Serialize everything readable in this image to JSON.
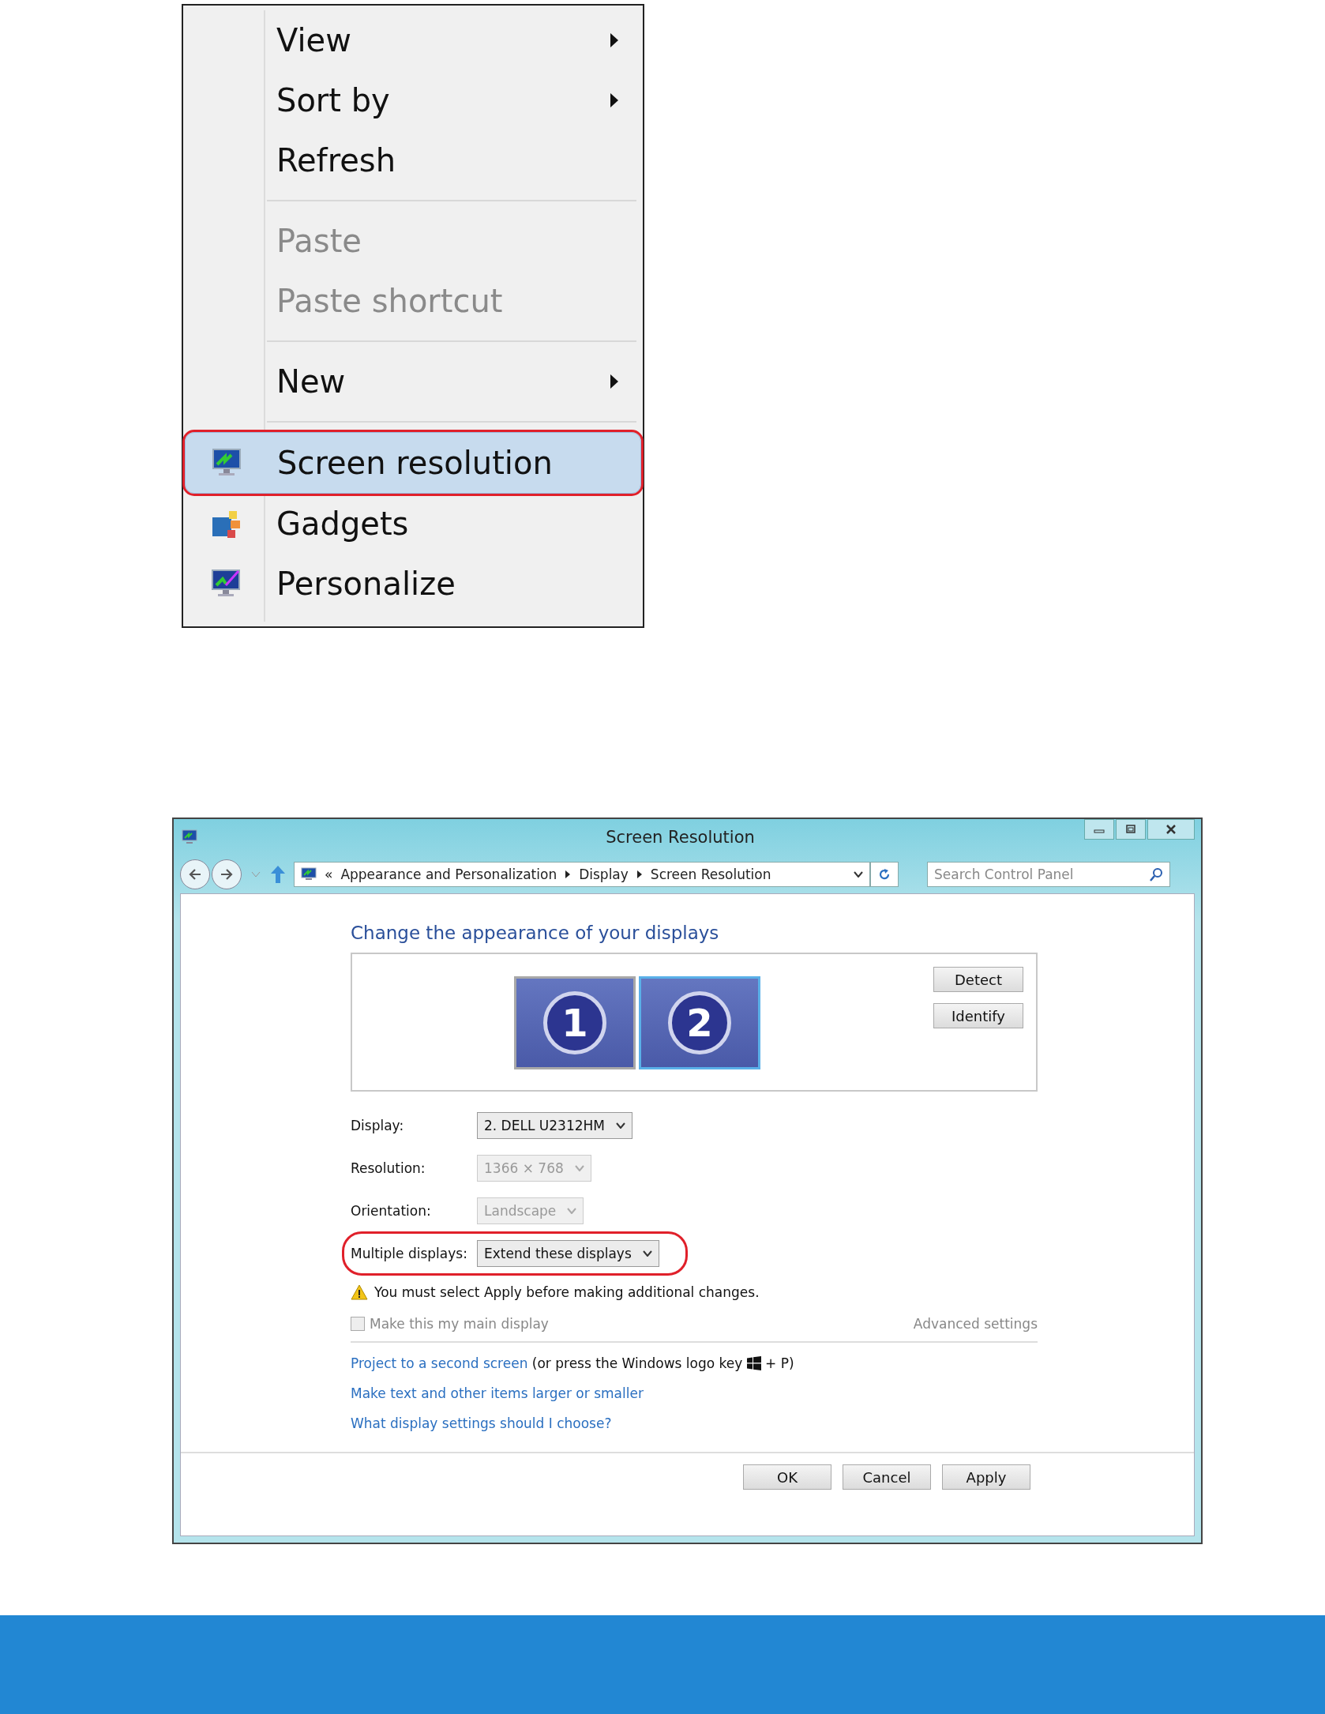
{
  "context_menu": {
    "sections": [
      {
        "items": [
          {
            "label": "View",
            "submenu": true,
            "disabled": false,
            "selected": false,
            "callout": false,
            "kind": "plain"
          },
          {
            "label": "Sort by",
            "submenu": true,
            "disabled": false,
            "selected": false,
            "callout": false,
            "kind": "plain"
          },
          {
            "label": "Refresh",
            "submenu": false,
            "disabled": false,
            "selected": false,
            "callout": false,
            "kind": "plain"
          }
        ]
      },
      {
        "items": [
          {
            "label": "Paste",
            "submenu": false,
            "disabled": true,
            "selected": false,
            "callout": false,
            "kind": "plain"
          },
          {
            "label": "Paste shortcut",
            "submenu": false,
            "disabled": true,
            "selected": false,
            "callout": false,
            "kind": "plain"
          }
        ]
      },
      {
        "items": [
          {
            "label": "New",
            "submenu": true,
            "disabled": false,
            "selected": false,
            "callout": false,
            "kind": "plain"
          }
        ]
      },
      {
        "items": [
          {
            "label": "Screen resolution",
            "submenu": false,
            "disabled": false,
            "selected": true,
            "callout": true,
            "kind": "monitor"
          },
          {
            "label": "Gadgets",
            "submenu": false,
            "disabled": false,
            "selected": false,
            "callout": false,
            "kind": "gadgets"
          },
          {
            "label": "Personalize",
            "submenu": false,
            "disabled": false,
            "selected": false,
            "callout": false,
            "kind": "brush"
          }
        ]
      }
    ]
  },
  "window": {
    "title": "Screen Resolution",
    "breadcrumb": [
      "Appearance and Personalization",
      "Display",
      "Screen Resolution"
    ],
    "breadcrumb_prefix": "«",
    "search": {
      "placeholder": "Search Control Panel"
    },
    "heading": "Change the appearance of your displays",
    "monitors": [
      {
        "label": "1",
        "selected": false
      },
      {
        "label": "2",
        "selected": true
      }
    ],
    "side_buttons": [
      "Detect",
      "Identify"
    ],
    "settings": [
      {
        "label": "Display:",
        "value": "2. DELL U2312HM",
        "disabled": false,
        "callout": false
      },
      {
        "label": "Resolution:",
        "value": "1366 × 768",
        "disabled": true,
        "callout": false
      },
      {
        "label": "Orientation:",
        "value": "Landscape",
        "disabled": true,
        "callout": false
      },
      {
        "label": "Multiple displays:",
        "value": "Extend these displays",
        "disabled": false,
        "callout": true
      }
    ],
    "warning": "You must select Apply before making additional changes.",
    "main_display": {
      "label": "Make this my main display",
      "checked": false,
      "disabled": true
    },
    "advanced_link": "Advanced settings",
    "project_line": {
      "link": "Project to a second screen",
      "before_icon": " (or press the Windows logo key ",
      "after_icon": " + P)"
    },
    "links": [
      "Make text and other items larger or smaller",
      "What display settings should I choose?"
    ],
    "buttons": [
      "OK",
      "Cancel",
      "Apply"
    ]
  }
}
